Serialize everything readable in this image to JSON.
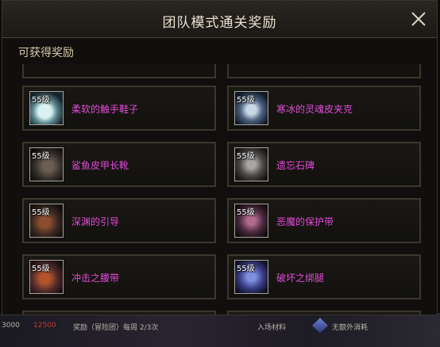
{
  "dialog": {
    "title": "团队模式通关奖励",
    "section_label": "可获得奖励"
  },
  "rewards": [
    {
      "level": "",
      "name": ""
    },
    {
      "level": "",
      "name": ""
    },
    {
      "level": "55级",
      "name": "柔软的触手鞋子",
      "icon": "tentacle-boots-icon"
    },
    {
      "level": "55级",
      "name": "寒冰的灵魂皮夹克",
      "icon": "ice-soul-jacket-icon"
    },
    {
      "level": "55级",
      "name": "鲨鱼皮甲长靴",
      "icon": "sharkskin-boots-icon"
    },
    {
      "level": "55级",
      "name": "遗忘石碑",
      "icon": "forgotten-stele-icon"
    },
    {
      "level": "55级",
      "name": "深渊的引导",
      "icon": "abyss-guide-icon"
    },
    {
      "level": "55级",
      "name": "恶魔的保护带",
      "icon": "demon-belt-icon"
    },
    {
      "level": "55级",
      "name": "冲击之腰带",
      "icon": "impact-belt-icon"
    },
    {
      "level": "55级",
      "name": "破坏之绑腿",
      "icon": "destruction-leggings-icon"
    }
  ],
  "background_strip": {
    "left_number": "3000",
    "red_number": "12500",
    "reward_text": "奖励（冒险团）每周 2/3次",
    "material_text": "入场材料",
    "no_extra_text": "无额外消耗"
  },
  "colors": {
    "item_name": "#e24bd7",
    "title": "#e9e1d2",
    "subhead": "#d8c9a8"
  }
}
